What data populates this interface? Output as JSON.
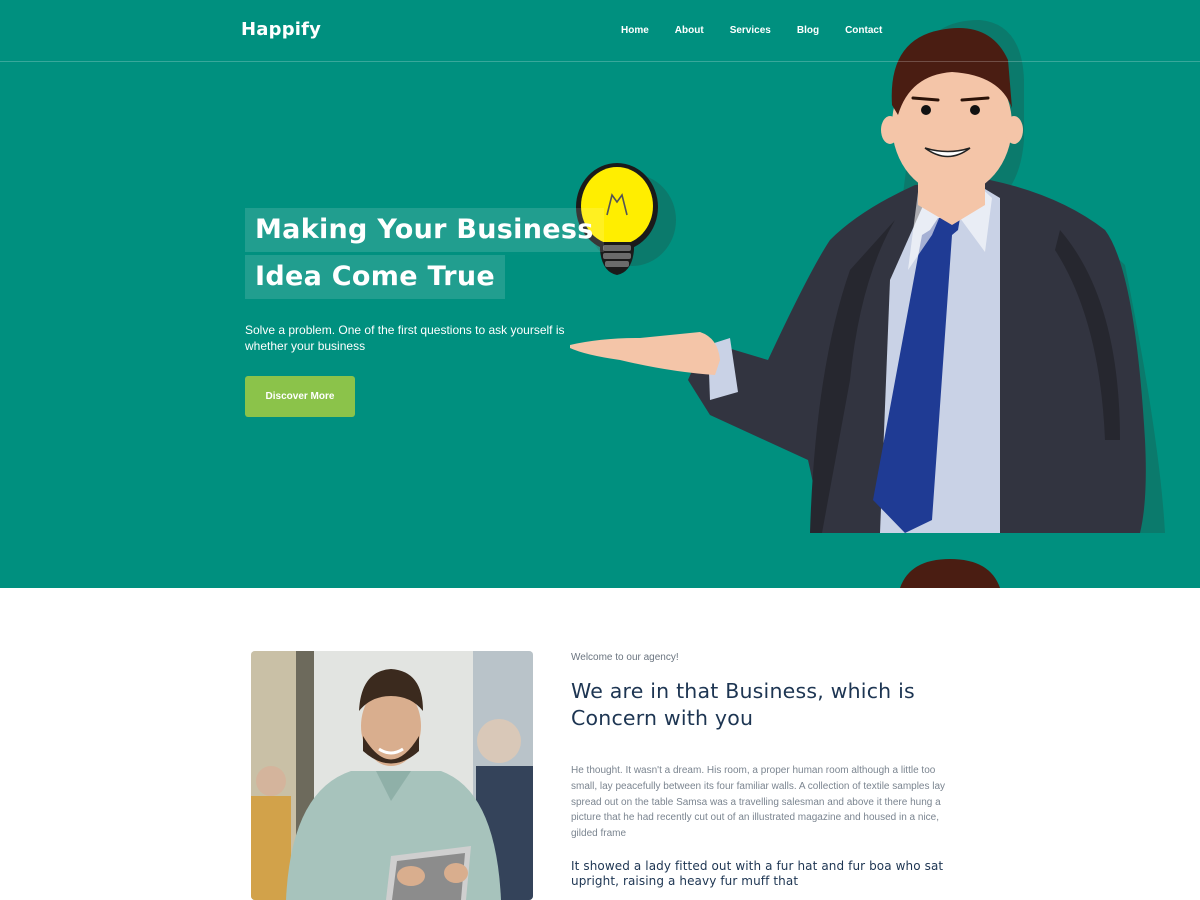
{
  "brand": {
    "name": "Happify",
    "accent": "#00907f",
    "button_color": "#8bc34a"
  },
  "nav": {
    "items": [
      "Home",
      "About",
      "Services",
      "Blog",
      "Contact"
    ]
  },
  "hero": {
    "headline_line1": "Making Your Business",
    "headline_line2": "Idea Come True",
    "subtitle": "Solve a problem. One of the first questions to ask yourself is whether your business",
    "cta_label": "Discover More",
    "illustration_icons": [
      "lightbulb-icon",
      "businessman-illustration"
    ]
  },
  "about": {
    "eyebrow": "Welcome to our agency!",
    "title": "We are in that Business, which is Concern with you",
    "body": "He thought. It wasn't a dream. His room, a proper human room although a little too small, lay peacefully between its four familiar walls. A collection of textile samples lay spread out on the table Samsa was a travelling salesman and above it there hung a picture that he had recently cut out of an illustrated magazine and housed in a nice, gilded frame",
    "quote": "It showed a lady fitted out with a fur hat and fur boa who sat upright, raising a heavy fur muff that"
  }
}
